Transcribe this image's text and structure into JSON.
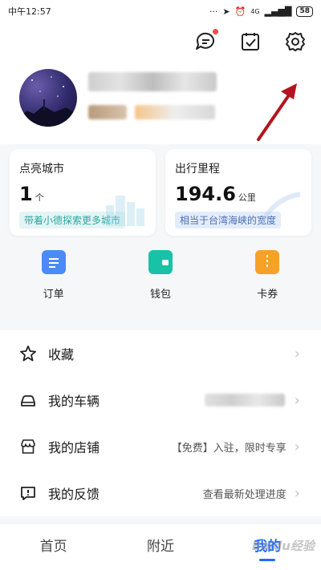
{
  "status_bar": {
    "time": "中午12:57",
    "dots": "···",
    "network": "4G",
    "battery": "58"
  },
  "header": {
    "icons": [
      "message-icon",
      "task-check-icon",
      "settings-gear-icon"
    ]
  },
  "stats": [
    {
      "title": "点亮城市",
      "value": "1",
      "unit": "个",
      "tag": "带着小德探索更多城市"
    },
    {
      "title": "出行里程",
      "value": "194.6",
      "unit": "公里",
      "tag": "相当于台湾海峡的宽度"
    }
  ],
  "quick_actions": [
    {
      "label": "订单",
      "icon": "order-icon",
      "color": "#4a8bf5"
    },
    {
      "label": "钱包",
      "icon": "wallet-icon",
      "color": "#18c2a6"
    },
    {
      "label": "卡券",
      "icon": "coupon-icon",
      "color": "#f7a127"
    }
  ],
  "menu": [
    {
      "label": "收藏",
      "right": "",
      "icon": "star-icon"
    },
    {
      "label": "我的车辆",
      "right": "",
      "icon": "car-icon"
    },
    {
      "label": "我的店铺",
      "right": "【免费】入驻，限时专享",
      "icon": "shop-icon"
    },
    {
      "label": "我的反馈",
      "right": "查看最新处理进度",
      "icon": "feedback-icon"
    }
  ],
  "bottom_nav": [
    "首页",
    "附近",
    "我的"
  ],
  "watermark": "Baidu经验",
  "colors": {
    "accent": "#1e6bff",
    "annotation_arrow": "#b3141f"
  }
}
